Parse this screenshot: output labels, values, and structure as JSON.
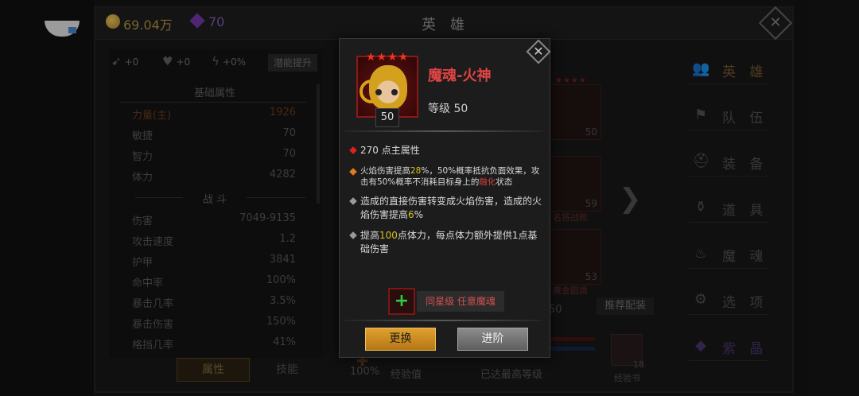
{
  "header": {
    "gold": "69.04万",
    "gems": "70",
    "title": "英 雄"
  },
  "bonuses": {
    "b1": "+0",
    "b2": "+0",
    "b3": "+0%",
    "potential_button": "潜能提升"
  },
  "sections": {
    "basic": "基础属性",
    "combat": "战 斗"
  },
  "basic_stats": [
    {
      "label": "力量(主)",
      "value": "1926"
    },
    {
      "label": "敏捷",
      "value": "70"
    },
    {
      "label": "智力",
      "value": "70"
    },
    {
      "label": "体力",
      "value": "4282"
    }
  ],
  "combat_stats": [
    {
      "label": "伤害",
      "value": "7049-9135"
    },
    {
      "label": "攻击速度",
      "value": "1.2"
    },
    {
      "label": "护甲",
      "value": "3841"
    },
    {
      "label": "命中率",
      "value": "100%"
    },
    {
      "label": "暴击几率",
      "value": "3.5%"
    },
    {
      "label": "暴击伤害",
      "value": "150%"
    },
    {
      "label": "格挡几率",
      "value": "41%"
    }
  ],
  "left_tabs": {
    "attributes": "属性",
    "skills": "技能"
  },
  "middle": {
    "card1_level": "50",
    "card2_count": "59",
    "card2_label": "名将战靴",
    "card3_count": "53",
    "card3_label": "黄金圆盾",
    "recommend": "推荐配装",
    "fifty": "50",
    "exp_pct": "100%",
    "exp_label": "经验值",
    "max_level": "已达最高等级",
    "exp_book_count": "18",
    "exp_book_label": "经验书"
  },
  "nav": [
    {
      "label": "英 雄",
      "icon": "hero-icon"
    },
    {
      "label": "队 伍",
      "icon": "flag-icon"
    },
    {
      "label": "装 备",
      "icon": "helmet-icon"
    },
    {
      "label": "道 具",
      "icon": "bag-icon"
    },
    {
      "label": "魔 魂",
      "icon": "flame-icon"
    },
    {
      "label": "选 项",
      "icon": "gear-icon"
    },
    {
      "label": "紫 晶",
      "icon": "amethyst-icon"
    }
  ],
  "popup": {
    "name": "魔魂-火神",
    "stars": "★★★★",
    "level_badge": "50",
    "level_text": "等级 50",
    "attr1": "270 点主属性",
    "attr2_a": "火焰伤害提高",
    "attr2_b": "28",
    "attr2_c": "%，50%概率抵抗负面效果，攻击有50%概率不消耗目标身上的",
    "attr2_d": "融化",
    "attr2_e": "状态",
    "attr3_a": "造成的直接伤害转变成火焰伤害，造成的火焰伤害提高",
    "attr3_b": "6",
    "attr3_c": "%",
    "attr4_a": "提高",
    "attr4_b": "100",
    "attr4_c": "点体力，每点体力额外提供1点基础伤害",
    "requirement": "同星级 任意魔魂",
    "replace_button": "更换",
    "advance_button": "进阶"
  },
  "colors": {
    "hero_name": "#e04444",
    "highlight_yellow": "#d6c020",
    "replace_button": "#d89a28",
    "advance_button": "#7a7a7a"
  }
}
